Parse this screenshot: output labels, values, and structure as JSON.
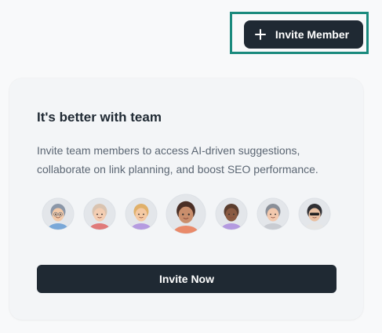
{
  "header": {
    "invite_member_label": "Invite Member",
    "invite_member_icon": "plus-icon"
  },
  "card": {
    "title": "It's better with team",
    "description": "Invite team members to access AI-driven suggestions, collaborate on link planning, and boost SEO performance.",
    "invite_now_label": "Invite Now"
  },
  "avatars": [
    {
      "name": "avatar-man-glasses",
      "hair": "#8b97a8",
      "shirt": "#7aa8d8",
      "skin": "#f2c9a8"
    },
    {
      "name": "avatar-woman-grey-hair",
      "hair": "#d9c3b0",
      "shirt": "#e07a7a",
      "skin": "#f3cdb2"
    },
    {
      "name": "avatar-man-blond",
      "hair": "#e0b06a",
      "shirt": "#b59be0",
      "skin": "#f4c9a3"
    },
    {
      "name": "avatar-woman-dark-hair",
      "hair": "#4a2f26",
      "shirt": "#e98a6a",
      "skin": "#c98e6c"
    },
    {
      "name": "avatar-man-bald-dark",
      "hair": "#5a3d2e",
      "shirt": "#b49ae0",
      "skin": "#8a5a42"
    },
    {
      "name": "avatar-woman-curly",
      "hair": "#8a8f98",
      "shirt": "#c9ccd2",
      "skin": "#f2c8ad"
    },
    {
      "name": "avatar-man-sunglasses",
      "hair": "#2f2f33",
      "shirt": "#e6e6e6",
      "skin": "#e8c0a2"
    }
  ],
  "colors": {
    "primary": "#1f2933",
    "highlight": "#1a8a7d",
    "card_bg": "#f3f5f7",
    "text_muted": "#5b6673"
  }
}
